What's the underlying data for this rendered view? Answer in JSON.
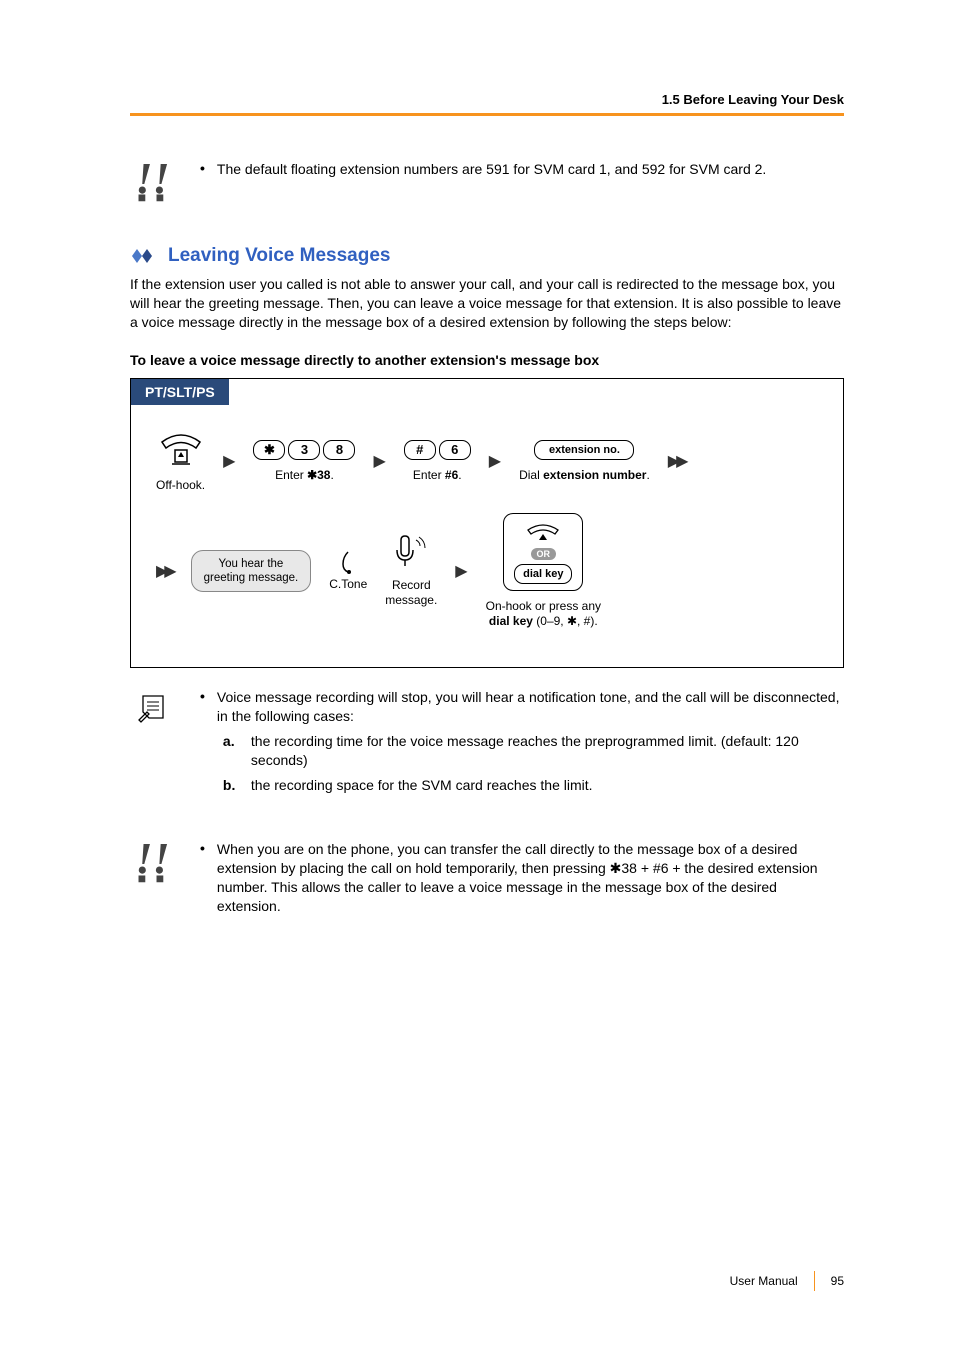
{
  "header": {
    "section_label": "1.5 Before Leaving Your Desk"
  },
  "tip1": {
    "text": "The default floating extension numbers are 591 for SVM card 1, and 592 for SVM card 2."
  },
  "section": {
    "title": "Leaving Voice Messages",
    "intro": "If the extension user you called is not able to answer your call, and your call is redirected to the message box, you will hear the greeting message. Then, you can leave a voice message for that extension. It is also possible to leave a voice message directly in the message box of a desired extension by following the steps below:",
    "sub_heading": "To leave a voice message directly to another extension's message box"
  },
  "procedure": {
    "tab": "PT/SLT/PS",
    "step1_caption": "Off-hook.",
    "step2_keys": [
      "  ",
      "3",
      "8"
    ],
    "step2_star": "✱",
    "step2_caption_prefix": "Enter ",
    "step2_caption_bold": "✱38",
    "step2_caption_suffix": ".",
    "step3_keys": [
      "#",
      "6"
    ],
    "step3_caption_prefix": "Enter ",
    "step3_caption_bold": "#6",
    "step3_caption_suffix": ".",
    "step4_key": "extension no.",
    "step4_caption_prefix": "Dial ",
    "step4_caption_bold": "extension number",
    "step4_caption_suffix": ".",
    "greeting_line1": "You hear the",
    "greeting_line2": "greeting message.",
    "ctone": "C.Tone",
    "record_line1": "Record",
    "record_line2": "message.",
    "or": "OR",
    "dialkey": "dial key",
    "onhook_line1": "On-hook or press any",
    "onhook_line2_bold": "dial key",
    "onhook_line2_rest": " (0–9, ✱, #)."
  },
  "note": {
    "lead": "Voice message recording will stop, you will hear a notification tone, and the call will be disconnected, in the following cases:",
    "a": "the recording time for the voice message reaches the preprogrammed limit. (default: 120 seconds)",
    "b": "the recording space for the SVM card reaches the limit."
  },
  "tip2": {
    "text": "When you are on the phone, you can transfer the call directly to the message box of a desired extension by placing the call on hold temporarily, then pressing ✱38 + #6 + the desired extension number. This allows the caller to leave a voice message in the message box of the desired extension."
  },
  "footer": {
    "doc": "User Manual",
    "page": "95"
  }
}
